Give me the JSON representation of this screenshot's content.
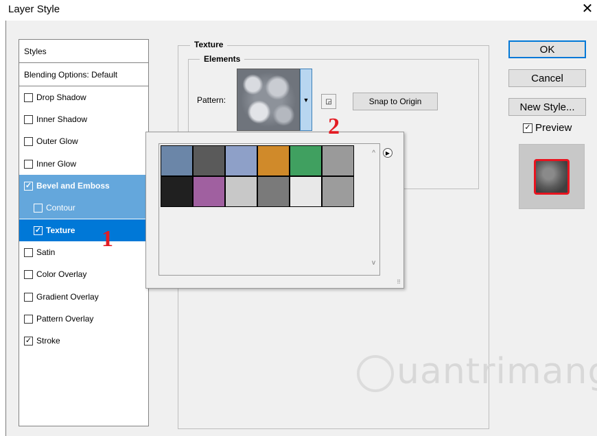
{
  "window": {
    "title": "Layer Style",
    "close_glyph": "✕"
  },
  "styles_panel": {
    "header": "Styles",
    "blending": "Blending Options: Default",
    "items": [
      {
        "label": "Drop Shadow",
        "checked": false
      },
      {
        "label": "Inner Shadow",
        "checked": false
      },
      {
        "label": "Outer Glow",
        "checked": false
      },
      {
        "label": "Inner Glow",
        "checked": false
      },
      {
        "label": "Bevel and Emboss",
        "checked": true
      },
      {
        "label": "Contour",
        "checked": false
      },
      {
        "label": "Texture",
        "checked": true
      },
      {
        "label": "Satin",
        "checked": false
      },
      {
        "label": "Color Overlay",
        "checked": false
      },
      {
        "label": "Gradient Overlay",
        "checked": false
      },
      {
        "label": "Pattern Overlay",
        "checked": false
      },
      {
        "label": "Stroke",
        "checked": true
      }
    ]
  },
  "texture": {
    "group_title": "Texture",
    "elements_title": "Elements",
    "pattern_label": "Pattern:",
    "snap_button": "Snap to Origin"
  },
  "pattern_picker": {
    "swatches": [
      {
        "name": "bubbles",
        "color": "#6b86a8"
      },
      {
        "name": "noise-dark",
        "color": "#5a5a5a"
      },
      {
        "name": "blue-cloth",
        "color": "#8ea0c8"
      },
      {
        "name": "orange-weave",
        "color": "#d08a2a"
      },
      {
        "name": "rainbow",
        "color": "#40a060"
      },
      {
        "name": "crackle-grey",
        "color": "#9a9a9a"
      },
      {
        "name": "checker",
        "color": "#202020"
      },
      {
        "name": "colorful-noise",
        "color": "#a060a0"
      },
      {
        "name": "white-spots",
        "color": "#c8c8c8"
      },
      {
        "name": "fine-noise",
        "color": "#7a7a7a"
      },
      {
        "name": "zigzag",
        "color": "#e8e8e8"
      },
      {
        "name": "clouds",
        "color": "#9c9c9c"
      }
    ]
  },
  "buttons": {
    "ok": "OK",
    "cancel": "Cancel",
    "new_style": "New Style...",
    "preview": "Preview"
  },
  "markers": {
    "one": "1",
    "two": "2"
  },
  "watermark": "uantrimang"
}
